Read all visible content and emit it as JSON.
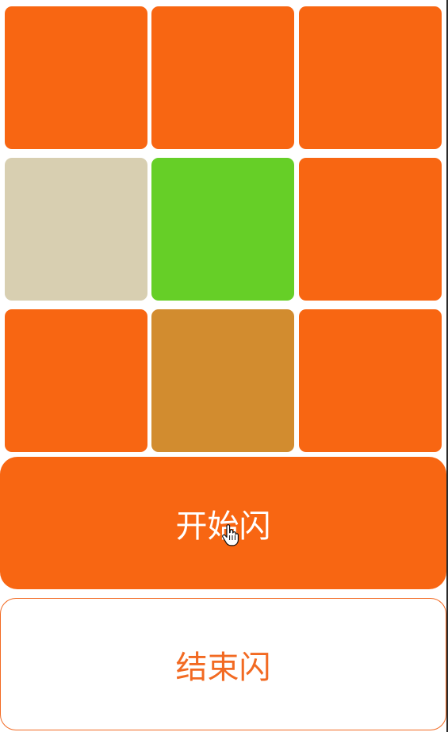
{
  "grid": {
    "tiles": [
      {
        "color": "#f86612"
      },
      {
        "color": "#f86612"
      },
      {
        "color": "#f86612"
      },
      {
        "color": "#d8cfb1"
      },
      {
        "color": "#66cf27"
      },
      {
        "color": "#f86612"
      },
      {
        "color": "#f86612"
      },
      {
        "color": "#d28c2f"
      },
      {
        "color": "#f86612"
      }
    ]
  },
  "buttons": {
    "start_label": "开始闪",
    "stop_label": "结束闪"
  },
  "colors": {
    "primary": "#f86612",
    "stop_text": "#f26a22",
    "stop_border": "#f26a22"
  },
  "cursor": {
    "icon": "hand-pointer-icon"
  }
}
